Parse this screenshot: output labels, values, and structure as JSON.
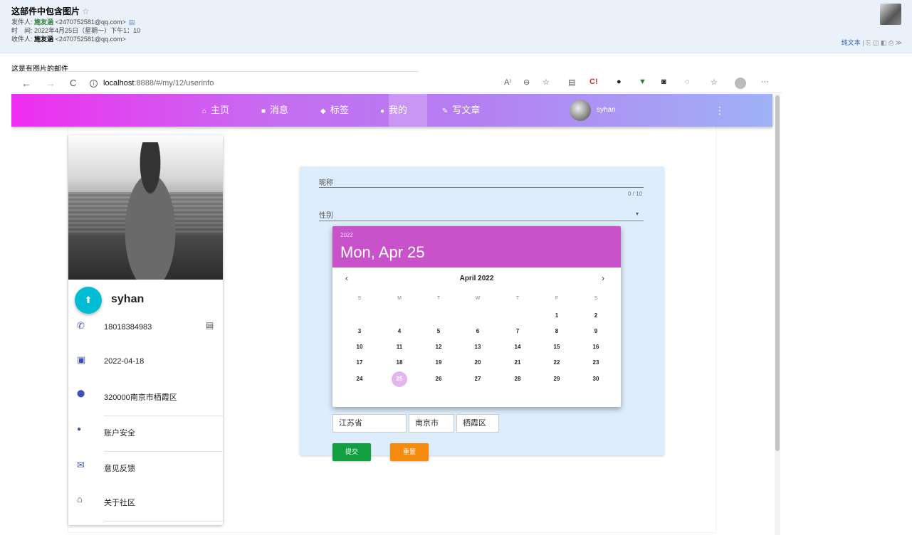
{
  "mail": {
    "subject": "这部件中包含图片",
    "star": "☆",
    "from_label": "发件人:",
    "from_name": "施友涵",
    "from_addr": "<2470752581@qq.com>",
    "card_icon": "▤",
    "time_label": "时　间:",
    "time_value": "2022年4月25日（星期一）下午1：10",
    "to_label": "收件人:",
    "to_name": "施友涵",
    "to_addr": "<2470752581@qq.com>",
    "plain_text": "纯文本",
    "tool_icons": "| ⎘ ◫ ◧ ⎙ ≫",
    "body_text": "这是有图片的邮件"
  },
  "browser": {
    "url_host": "localhost",
    "url_rest": ":8888/#/my/12/userinfo",
    "back": "←",
    "forward": "→",
    "refresh": "C",
    "info_icon": "i",
    "read_aloud": "A⁾",
    "zoom": "⊖",
    "favorite": "☆",
    "more": "···"
  },
  "nav": {
    "items": [
      {
        "icon": "⌂",
        "label": "主页"
      },
      {
        "icon": "■",
        "label": "消息"
      },
      {
        "icon": "◆",
        "label": "标签"
      },
      {
        "icon": "●",
        "label": "我的"
      },
      {
        "icon": "✎",
        "label": "写文章"
      }
    ],
    "user": "syhan",
    "more": "⋮"
  },
  "profile": {
    "name": "syhan",
    "upload_icon": "⬆",
    "phone_icon": "✆",
    "phone": "18018384983",
    "message_icon": "▤",
    "calendar_icon": "▣",
    "date": "2022-04-18",
    "location_icon": "⬤",
    "address": "320000南京市栖霞区",
    "security_icon": "●",
    "security": "账户安全",
    "feedback_icon": "✉",
    "feedback": "意见反馈",
    "about_icon": "⌂",
    "about": "关于社区"
  },
  "form": {
    "nickname_label": "昵称",
    "counter": "0 / 10",
    "gender_label": "性别",
    "caret": "▾",
    "province": "江苏省",
    "city": "南京市",
    "district": "栖霞区",
    "submit": "提交",
    "reset": "重置"
  },
  "picker": {
    "year": "2022",
    "date": "Mon, Apr 25",
    "month": "April 2022",
    "prev": "‹",
    "next": "›",
    "weekdays": [
      "S",
      "M",
      "T",
      "W",
      "T",
      "F",
      "S"
    ],
    "selected": "25",
    "weeks": [
      [
        "",
        "",
        "",
        "",
        "",
        "1",
        "2"
      ],
      [
        "3",
        "4",
        "5",
        "6",
        "7",
        "8",
        "9"
      ],
      [
        "10",
        "11",
        "12",
        "13",
        "14",
        "15",
        "16"
      ],
      [
        "17",
        "18",
        "19",
        "20",
        "21",
        "22",
        "23"
      ],
      [
        "24",
        "25",
        "26",
        "27",
        "28",
        "29",
        "30"
      ]
    ]
  },
  "colors": {
    "picker_header": "#c752c9",
    "submit": "#12a042",
    "reset": "#f68b0e",
    "fab": "#00bcd4"
  }
}
